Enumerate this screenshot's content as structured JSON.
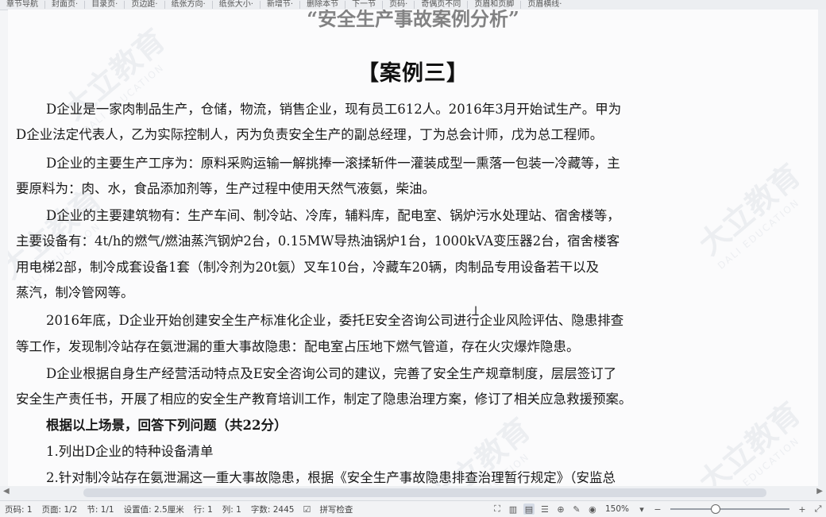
{
  "toolbar": {
    "items": [
      "章节导航",
      "封面页·",
      "目录页·",
      "页边距·",
      "纸张方向·",
      "纸张大小·",
      "新增节·",
      "删除本节",
      "下一节",
      "页码·",
      "奇偶页不同",
      "页眉和页脚",
      "页眉横线·"
    ]
  },
  "document": {
    "top_cut": "“安全生产事故案例分析”",
    "title": "【案例三】",
    "paragraphs": [
      "D企业是一家肉制品生产，仓储，物流，销售企业，现有员工612人。2016年3月开始试生产。甲为",
      "D企业法定代表人，乙为实际控制人，丙为负责安全生产的副总经理，丁为总会计师，戊为总工程师。",
      "D企业的主要生产工序为：原料采购运输一解挑捧一滚揉斩件一灌装成型一熏落一包装一冷藏等，主",
      "要原料为：肉、水，食品添加剂等，生产过程中使用天然气液氨，柴油。",
      "D企业的主要建筑物有：生产车间、制冷站、冷库，辅料库，配电室、锅炉污水处理站、宿舍楼等，",
      "主要设备有：4t/h的燃气/燃油蒸汽钢炉2台，0.15MW导热油锅炉1台，1000kVA变压器2台，宿舍楼客",
      "用电梯2部，制冷成套设备1套（制冷剂为20t氨）叉车10台，冷藏车20辆，肉制品专用设备若干以及",
      "蒸汽，制冷管网等。",
      "2016年底，D企业开始创建安全生产标准化企业，委托E安全咨询公司进行企业风险评估、隐患排查",
      "等工作，发现制冷站存在氨泄漏的重大事故隐患：配电室占压地下燃气管道，存在火灾爆炸隐患。",
      "D企业根据自身生产经营活动特点及E安全咨询公司的建议，完善了安全生产规章制度，层层签订了",
      "安全生产责任书，开展了相应的安全生产教育培训工作，制定了隐患治理方案，修订了相关应急救援预案。",
      "根据以上场景，回答下列问题（共22分）",
      "1.列出D企业的特种设备清单",
      "2.针对制冷站存在氨泄漏这一重大事故隐患，根据《安全生产事故隐患排查治理暂行规定》（安监总"
    ]
  },
  "watermark": {
    "text": "大立教育",
    "sub": "DALI EDUCATION"
  },
  "statusbar": {
    "page_code": "页码: 1",
    "page": "页面: 1/2",
    "section": "节: 1/1",
    "setting": "设置值: 2.5厘米",
    "row": "行: 1",
    "col": "列: 1",
    "words": "字数: 2445",
    "spellcheck": "拼写检查",
    "zoom": "150%",
    "zoom_level": 0.38
  }
}
